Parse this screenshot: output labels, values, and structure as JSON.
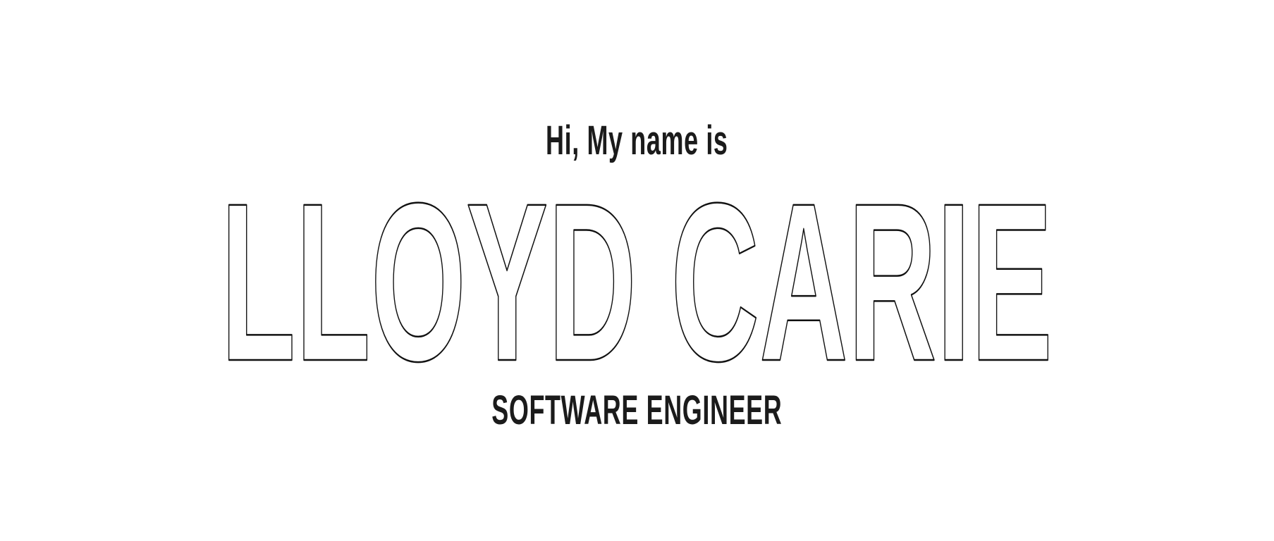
{
  "hero": {
    "greeting": "Hi, My name is",
    "name": "LLOYD CARIE",
    "role": "SOFTWARE ENGINEER"
  },
  "colors": {
    "background": "#ffffff",
    "text": "#1b1b1b",
    "outline": "#111111"
  }
}
